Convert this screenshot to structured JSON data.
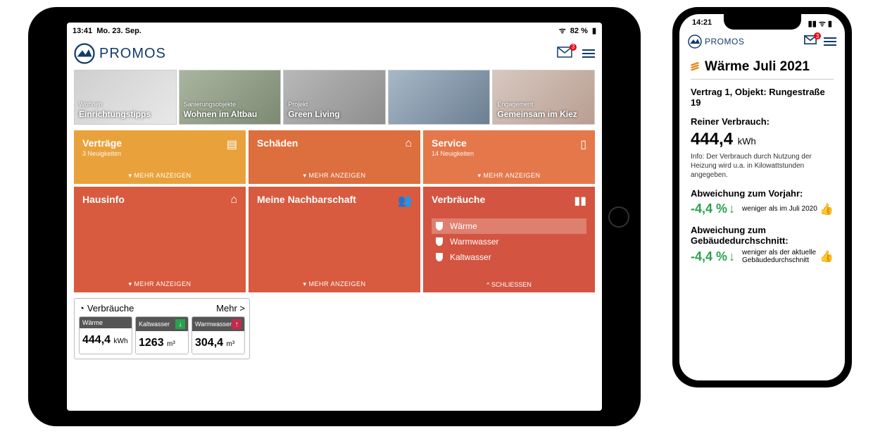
{
  "tablet": {
    "status": {
      "time": "13:41",
      "date": "Mo. 23. Sep.",
      "battery": "82 %"
    },
    "brand": "PROMOS",
    "mail_badge": "3",
    "banners": [
      {
        "cat": "Wohnen",
        "title": "Einrichtungstipps"
      },
      {
        "cat": "Sanierungsobjekte",
        "title": "Wohnen im Altbau"
      },
      {
        "cat": "Projekt",
        "title": "Green Living"
      },
      {
        "cat": "",
        "title": ""
      },
      {
        "cat": "Engagement",
        "title": "Gemeinsam im Kiez"
      }
    ],
    "tiles": {
      "vertraege": {
        "title": "Verträge",
        "sub": "3 Neuigkeiten",
        "more": "▾ MEHR ANZEIGEN"
      },
      "schaeden": {
        "title": "Schäden",
        "more": "▾ MEHR ANZEIGEN"
      },
      "service": {
        "title": "Service",
        "sub": "14 Neuigkeiten",
        "more": "▾ MEHR ANZEIGEN"
      },
      "hausinfo": {
        "title": "Hausinfo",
        "more": "▾ MEHR ANZEIGEN"
      },
      "nachbar": {
        "title": "Meine Nachbarschaft",
        "more": "▾ MEHR ANZEIGEN"
      },
      "verbrauch": {
        "title": "Verbräuche",
        "items": [
          "Wärme",
          "Warmwasser",
          "Kaltwasser"
        ],
        "close": "^ SCHLIESSEN"
      }
    },
    "widget": {
      "title": "Verbräuche",
      "more": "Mehr >",
      "cards": [
        {
          "label": "Wärme",
          "value": "444,4",
          "unit": "kWh",
          "dir": "none"
        },
        {
          "label": "Kaltwasser",
          "value": "1263",
          "unit": "m³",
          "dir": "down"
        },
        {
          "label": "Warmwasser",
          "value": "304,4",
          "unit": "m³",
          "dir": "up"
        }
      ]
    }
  },
  "phone": {
    "status": {
      "time": "14:21"
    },
    "brand": "PROMOS",
    "mail_badge": "3",
    "page": {
      "title": "Wärme Juli 2021",
      "contract": "Vertrag 1, Objekt: Rungestraße 19",
      "label_reiner": "Reiner Verbrauch:",
      "value": "444,4",
      "unit": "kWh",
      "info": "Info: Der Verbrauch durch Nutzung der Heizung wird u.a. in Kilowattstunden angegeben.",
      "dev1_label": "Abweichung zum Vorjahr:",
      "dev1_val": "-4,4 %",
      "dev1_txt": "weniger als im Juli 2020",
      "dev2_label": "Abweichung zum Gebäudedurchschnitt:",
      "dev2_val": "-4,4 %",
      "dev2_txt": "weniger als der aktuelle Gebäudedurchschnitt"
    }
  }
}
